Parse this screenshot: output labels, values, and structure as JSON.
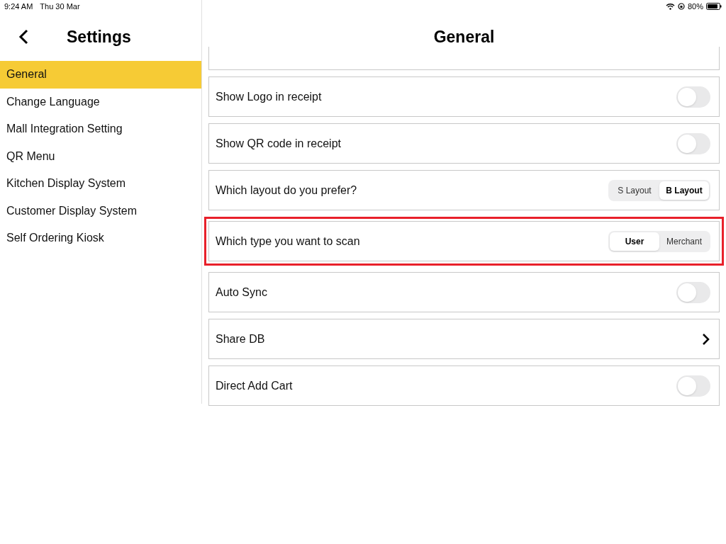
{
  "status_bar": {
    "time": "9:24 AM",
    "date": "Thu 30 Mar",
    "battery": "80%"
  },
  "sidebar": {
    "title": "Settings",
    "items": [
      {
        "label": "General",
        "selected": true
      },
      {
        "label": "Change Language",
        "selected": false
      },
      {
        "label": "Mall Integration Setting",
        "selected": false
      },
      {
        "label": "QR Menu",
        "selected": false
      },
      {
        "label": "Kitchen Display System",
        "selected": false
      },
      {
        "label": "Customer Display System",
        "selected": false
      },
      {
        "label": "Self Ordering Kiosk",
        "selected": false
      }
    ]
  },
  "main": {
    "title": "General",
    "rows": [
      {
        "kind": "toggle",
        "label": "Show Logo in receipt",
        "on": false,
        "highlighted": false
      },
      {
        "kind": "toggle",
        "label": "Show QR code in receipt",
        "on": false,
        "highlighted": false
      },
      {
        "kind": "segmented",
        "label": "Which layout do you prefer?",
        "highlighted": false,
        "options": [
          {
            "label": "S Layout",
            "selected": false
          },
          {
            "label": "B Layout",
            "selected": true
          }
        ]
      },
      {
        "kind": "segmented",
        "label": "Which type you want to scan",
        "highlighted": true,
        "options": [
          {
            "label": "User",
            "selected": true
          },
          {
            "label": "Merchant",
            "selected": false
          }
        ]
      },
      {
        "kind": "toggle",
        "label": "Auto Sync",
        "on": false,
        "highlighted": false
      },
      {
        "kind": "link",
        "label": "Share DB",
        "highlighted": false
      },
      {
        "kind": "toggle",
        "label": "Direct Add Cart",
        "on": false,
        "highlighted": false
      }
    ]
  }
}
